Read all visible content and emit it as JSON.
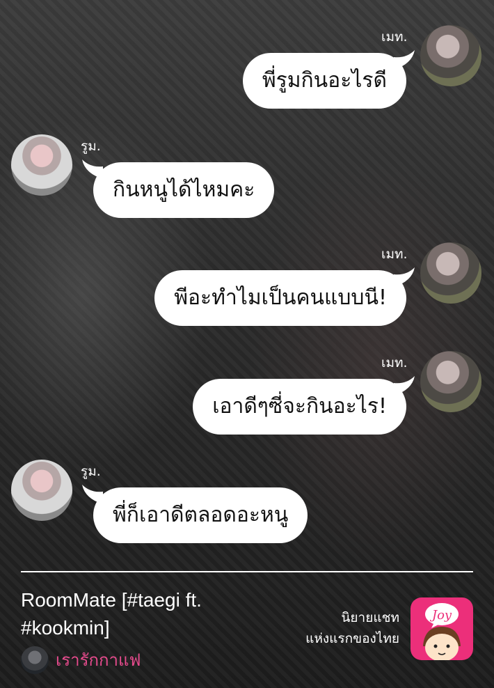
{
  "chat": [
    {
      "sender": "เมท.",
      "text": "พี่รูมกินอะไรดี",
      "side": "right"
    },
    {
      "sender": "รูม.",
      "text": "กินหนูได้ไหมคะ",
      "side": "left"
    },
    {
      "sender": "เมท.",
      "text": "พีอะทำไมเป็นคนแบบนี!",
      "side": "right"
    },
    {
      "sender": "เมท.",
      "text": "เอาดีๆซี่จะกินอะไร!",
      "side": "right"
    },
    {
      "sender": "รูม.",
      "text": "พี่ก็เอาดีตลอดอะหนู",
      "side": "left"
    }
  ],
  "footer": {
    "story_title": "RoomMate [#taegi ft. #kookmin]",
    "author": "เรารักกาแฟ",
    "promo_line1": "นิยายแชท",
    "promo_line2": "แห่งแรกของไทย",
    "app_icon_text": "Joy"
  },
  "colors": {
    "bubble": "#ffffff",
    "author": "#e64b8d",
    "app_icon_bg": "#ec2f7a"
  }
}
